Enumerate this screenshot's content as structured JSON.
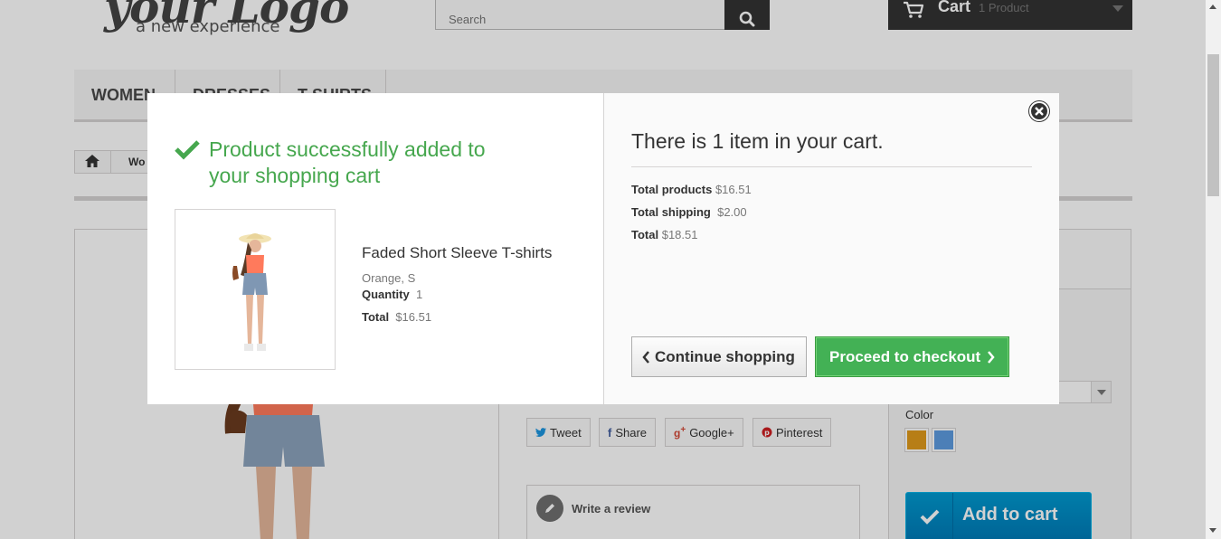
{
  "header": {
    "logo_main": "your Logo",
    "logo_sub": "a new experience",
    "search_placeholder": "Search",
    "cart_label": "Cart",
    "cart_count": "1 Product"
  },
  "menu": {
    "items": [
      {
        "label": "Women"
      },
      {
        "label": "Dresses"
      },
      {
        "label": "T-shirts"
      }
    ]
  },
  "breadcrumb": {
    "current": "Wo"
  },
  "product_page": {
    "color_label": "Color",
    "colors": [
      "#e09a1b",
      "#5d9ce0"
    ],
    "add_to_cart": "Add to cart",
    "share": {
      "tweet": "Tweet",
      "share": "Share",
      "google": "Google+",
      "pinterest": "Pinterest"
    },
    "write_review": "Write a review"
  },
  "modal": {
    "success_message": "Product successfully added to your shopping cart",
    "product": {
      "name": "Faded Short Sleeve T-shirts",
      "attributes": "Orange, S",
      "quantity_label": "Quantity",
      "quantity_value": "1",
      "total_label": "Total",
      "total_value": "$16.51"
    },
    "cart": {
      "title": "There is 1 item in your cart.",
      "total_products_label": "Total products",
      "total_products_value": "$16.51",
      "total_shipping_label": "Total shipping",
      "total_shipping_value": "$2.00",
      "total_label": "Total",
      "total_value": "$18.51"
    },
    "continue_label": "Continue shopping",
    "checkout_label": "Proceed to checkout"
  },
  "colors": {
    "success_green": "#46a74e",
    "checkout_green": "#43b155",
    "add_to_cart_blue": "#009ad0",
    "dark": "#333333"
  }
}
